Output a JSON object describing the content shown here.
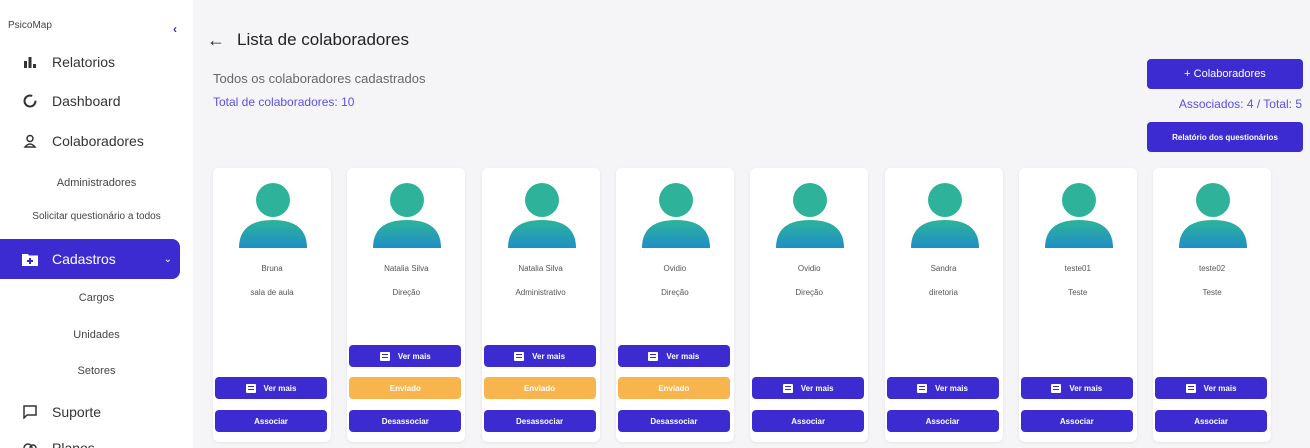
{
  "sidebar": {
    "brand": "PsicoMap",
    "items": [
      {
        "label": "Relatorios",
        "icon": "bar-chart-icon"
      },
      {
        "label": "Dashboard",
        "icon": "circle-icon"
      },
      {
        "label": "Colaboradores",
        "icon": "user-icon"
      }
    ],
    "sub_admin": "Administradores",
    "sub_solicitar": "Solicitar questionário a todos",
    "active": {
      "label": "Cadastros",
      "icon": "folder-plus-icon"
    },
    "cadastros_sub": [
      "Cargos",
      "Unidades",
      "Setores"
    ],
    "bottom": [
      {
        "label": "Suporte",
        "icon": "chat-icon"
      },
      {
        "label": "Planos",
        "icon": "coins-icon"
      }
    ]
  },
  "header": {
    "title": "Lista de colaboradores",
    "subtitle": "Todos os colaboradores cadastrados",
    "total": "Total de colaboradores: 10",
    "add_button": "+ Colaboradores",
    "assoc_status": "Associados: 4 / Total: 5",
    "report_button": "Relatório dos questionários"
  },
  "colors": {
    "accent": "#3c2bd0",
    "warn": "#f9b54d",
    "avatar_top": "#2eb39a",
    "avatar_bottom": "#1f8fc6"
  },
  "cards": [
    {
      "name": "Bruna",
      "dept": "sala de aula",
      "ver_mais": "Ver mais",
      "action": "Associar"
    },
    {
      "name": "Natalia Silva",
      "dept": "Direção",
      "ver_mais": "Ver mais",
      "status": "Enviado",
      "action": "Desassociar"
    },
    {
      "name": "Natalia Silva",
      "dept": "Administrativo",
      "ver_mais": "Ver mais",
      "status": "Enviado",
      "action": "Desassociar"
    },
    {
      "name": "Ovidio",
      "dept": "Direção",
      "ver_mais": "Ver mais",
      "status": "Enviado",
      "action": "Desassociar"
    },
    {
      "name": "Ovidio",
      "dept": "Direção",
      "ver_mais": "Ver mais",
      "action": "Associar"
    },
    {
      "name": "Sandra",
      "dept": "diretoria",
      "ver_mais": "Ver mais",
      "action": "Associar"
    },
    {
      "name": "teste01",
      "dept": "Teste",
      "ver_mais": "Ver mais",
      "action": "Associar"
    },
    {
      "name": "teste02",
      "dept": "Teste",
      "ver_mais": "Ver mais",
      "action": "Associar"
    }
  ]
}
